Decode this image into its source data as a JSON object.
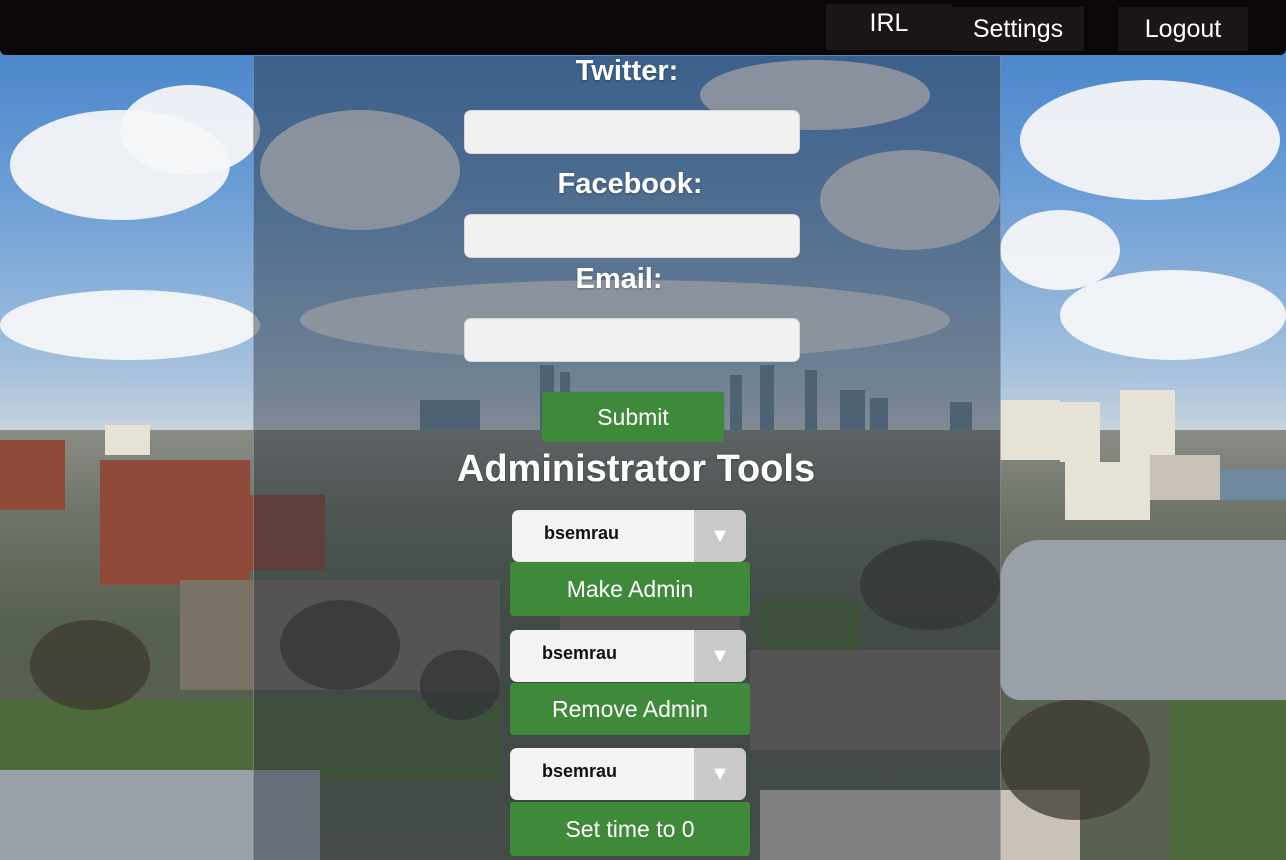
{
  "nav": {
    "irl": "IRL",
    "settings": "Settings",
    "logout": "Logout"
  },
  "form": {
    "twitter_label": "Twitter:",
    "facebook_label": "Facebook:",
    "email_label": "Email:",
    "twitter_value": "",
    "facebook_value": "",
    "email_value": "",
    "submit": "Submit"
  },
  "admin": {
    "heading": "Administrator Tools",
    "make_admin": {
      "selected_user": "bsemrau",
      "button": "Make Admin"
    },
    "remove_admin": {
      "selected_user": "bsemrau",
      "button": "Remove Admin"
    },
    "set_time": {
      "selected_user": "bsemrau",
      "button": "Set time to 0"
    }
  },
  "icons": {
    "dropdown_arrow": "triangle-down"
  },
  "colors": {
    "topbar": "#0b0707",
    "button_green": "#3e8a3a",
    "input_bg": "#f1f1f1"
  }
}
